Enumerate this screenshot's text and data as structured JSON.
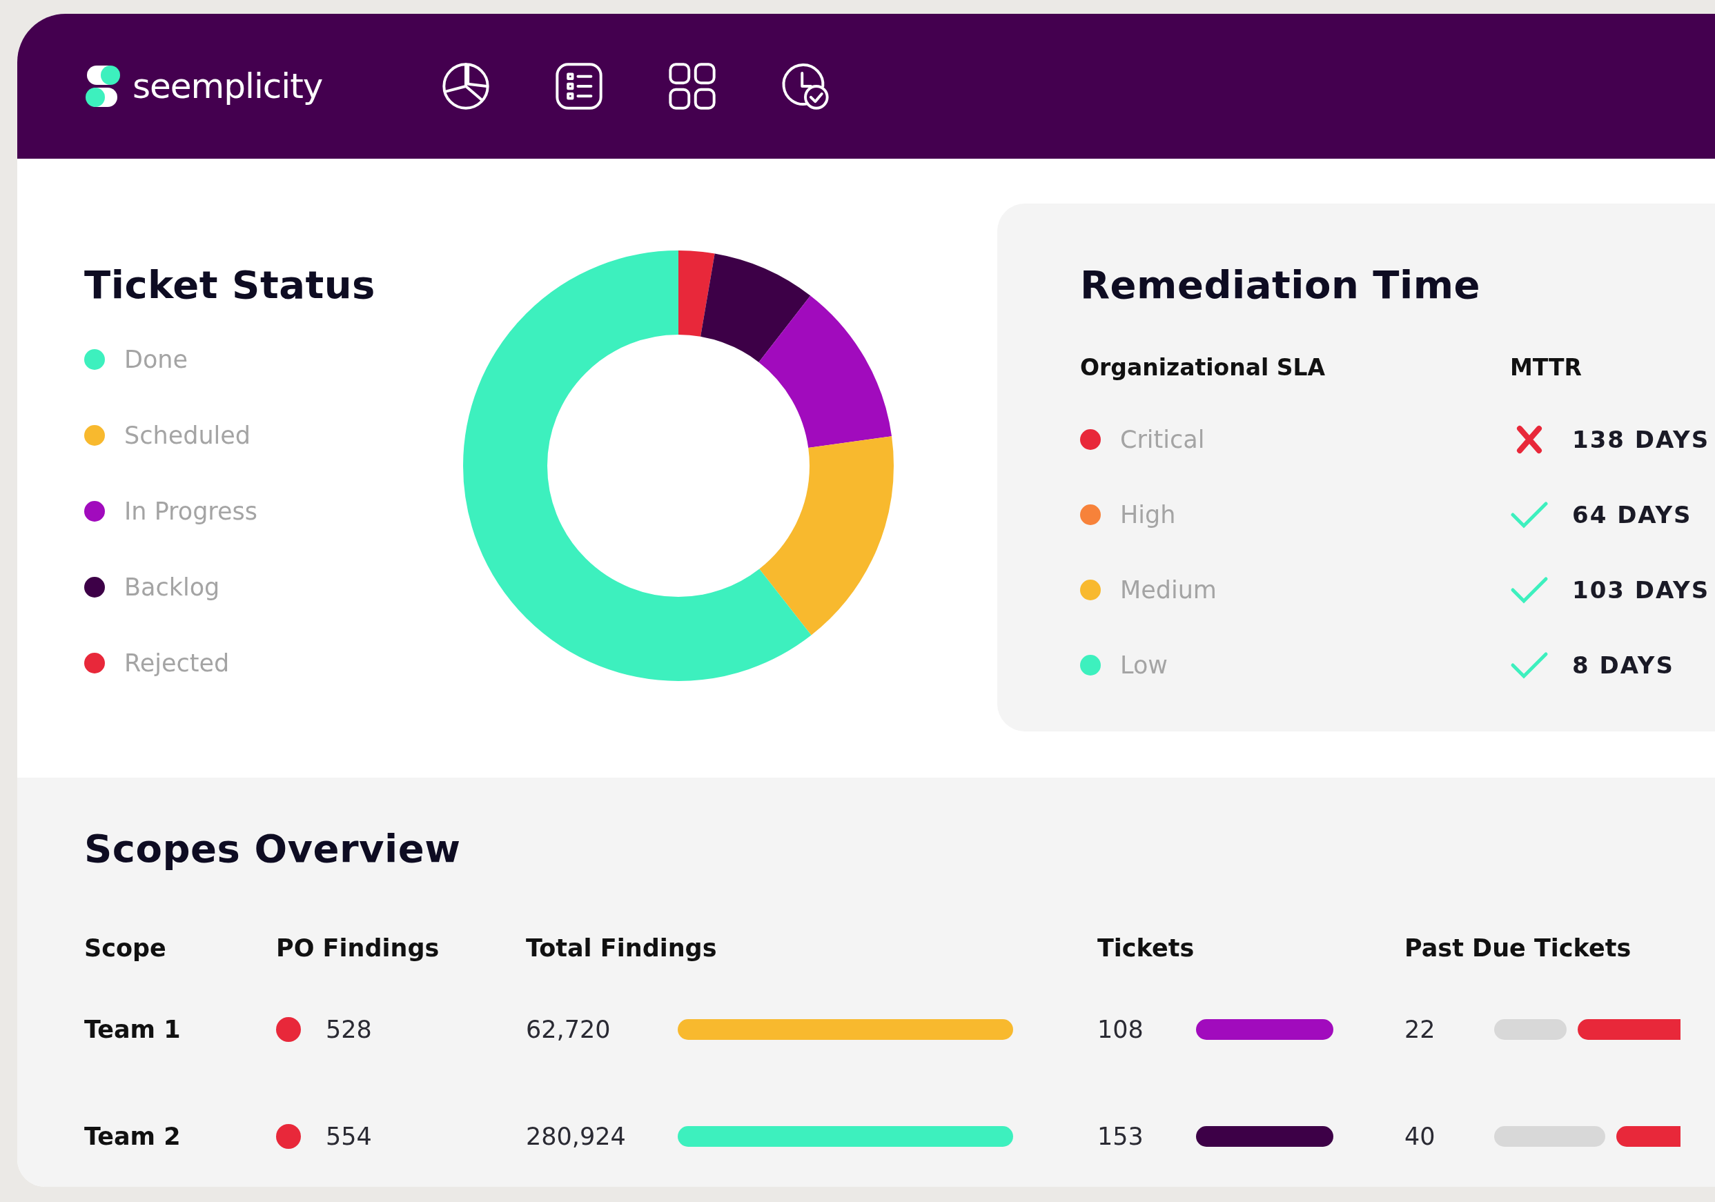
{
  "header": {
    "logo": "seemplicity"
  },
  "ticket_status": {
    "title": "Ticket Status",
    "legend": [
      {
        "label": "Done",
        "color": "#3df0be"
      },
      {
        "label": "Scheduled",
        "color": "#f8b92e"
      },
      {
        "label": "In Progress",
        "color": "#a10bbd"
      },
      {
        "label": "Backlog",
        "color": "#3d0047"
      },
      {
        "label": "Rejected",
        "color": "#e8283a"
      }
    ]
  },
  "remediation": {
    "title": "Remediation Time",
    "columns": [
      "Organizational SLA",
      "MTTR"
    ],
    "rows": [
      {
        "severity": "Critical",
        "color": "#e8283a",
        "sla_met": false,
        "mttr": "138 DAYS"
      },
      {
        "severity": "High",
        "color": "#f7823a",
        "sla_met": true,
        "mttr": "64 DAYS"
      },
      {
        "severity": "Medium",
        "color": "#f8b92e",
        "sla_met": true,
        "mttr": "103 DAYS"
      },
      {
        "severity": "Low",
        "color": "#3df0be",
        "sla_met": true,
        "mttr": "8 DAYS"
      }
    ]
  },
  "scopes": {
    "title": "Scopes Overview",
    "columns": [
      "Scope",
      "PO Findings",
      "Total Findings",
      "Tickets",
      "Past Due Tickets"
    ],
    "rows": [
      {
        "scope": "Team 1",
        "po_findings": {
          "value": "528",
          "color": "#e8283a"
        },
        "total_findings": {
          "value": "62,720",
          "color": "#f8b92e"
        },
        "tickets": {
          "value": "108",
          "color": "#a10bbd"
        },
        "past_due": {
          "value": "22"
        }
      },
      {
        "scope": "Team 2",
        "po_findings": {
          "value": "554",
          "color": "#e8283a"
        },
        "total_findings": {
          "value": "280,924",
          "color": "#3df0be"
        },
        "tickets": {
          "value": "153",
          "color": "#3d0047"
        },
        "past_due": {
          "value": "40"
        }
      }
    ]
  }
}
